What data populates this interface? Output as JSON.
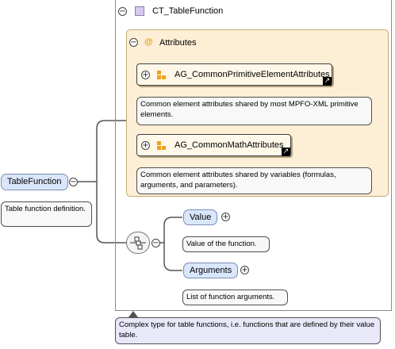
{
  "complex_type": {
    "name": "CT_TableFunction",
    "doc": "Complex type for table functions, i.e. functions that are defined by their value table."
  },
  "attributes_group": {
    "symbol": "@",
    "label": "Attributes"
  },
  "attribute_groups": [
    {
      "name": "AG_CommonPrimitiveElementAttributes",
      "doc": "Common element attributes shared by most MPFO-XML primitive elements."
    },
    {
      "name": "AG_CommonMathAttributes",
      "doc": "Common element attributes shared by variables (formulas, arguments, and parameters)."
    }
  ],
  "root_element": {
    "name": "TableFunction",
    "doc": "Table function definition."
  },
  "children": [
    {
      "name": "Value",
      "doc": "Value of the function."
    },
    {
      "name": "Arguments",
      "doc": "List of function arguments."
    }
  ],
  "icons": {
    "collapse": "minus-circle-icon",
    "expand": "plus-circle-icon",
    "type": "complex-type-icon",
    "group": "attribute-group-icon",
    "link": "external-link-icon",
    "sequence": "sequence-compositor-icon"
  },
  "colors": {
    "element_fill": "#d9e6fb",
    "attributes_fill": "#fdeed6",
    "attribute_group_fill": "#fff8e8",
    "doc_fill": "#f8f8f8",
    "type_doc_fill": "#e8e8f8"
  }
}
